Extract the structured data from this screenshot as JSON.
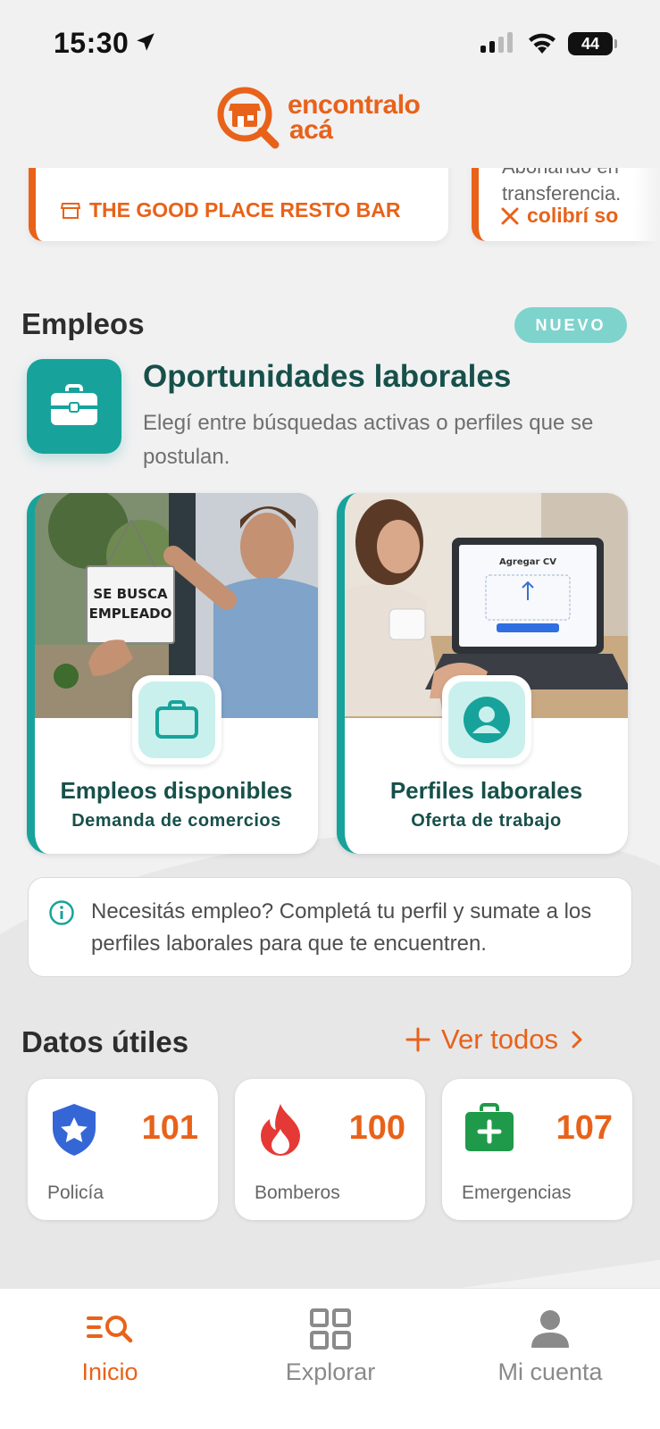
{
  "status_bar": {
    "time": "15:30",
    "battery": "44"
  },
  "logo": {
    "line1": "encontralo",
    "line2": "acá"
  },
  "promos": [
    {
      "store": "THE GOOD PLACE RESTO BAR"
    },
    {
      "description_line1": "Abonando en",
      "description_line2": "transferencia.",
      "store": "colibrí so"
    }
  ],
  "empleos": {
    "section_title": "Empleos",
    "badge": "NUEVO",
    "title": "Oportunidades laborales",
    "subtitle": "Elegí entre búsquedas activas o perfiles que se postulan.",
    "cards": [
      {
        "title": "Empleos disponibles",
        "subtitle": "Demanda de comercios",
        "photo_sign_line1": "SE BUSCA",
        "photo_sign_line2": "EMPLEADO"
      },
      {
        "title": "Perfiles laborales",
        "subtitle": "Oferta de trabajo",
        "photo_screen_title": "Agregar CV"
      }
    ],
    "info": "Necesitás empleo? Completá tu perfil y sumate a los perfiles laborales para que te encuentren."
  },
  "datos_utiles": {
    "title": "Datos útiles",
    "ver_todos": "Ver todos",
    "items": [
      {
        "label": "Policía",
        "number": "101",
        "icon": "shield-star-icon",
        "color": "#3566d6"
      },
      {
        "label": "Bomberos",
        "number": "100",
        "icon": "flame-icon",
        "color": "#e53935"
      },
      {
        "label": "Emergencias",
        "number": "107",
        "icon": "first-aid-icon",
        "color": "#1f9a4a"
      }
    ]
  },
  "nav": {
    "items": [
      {
        "label": "Inicio"
      },
      {
        "label": "Explorar"
      },
      {
        "label": "Mi cuenta"
      }
    ]
  },
  "colors": {
    "brand_orange": "#e8621a",
    "teal": "#17a39b",
    "teal_dark": "#17504a"
  }
}
